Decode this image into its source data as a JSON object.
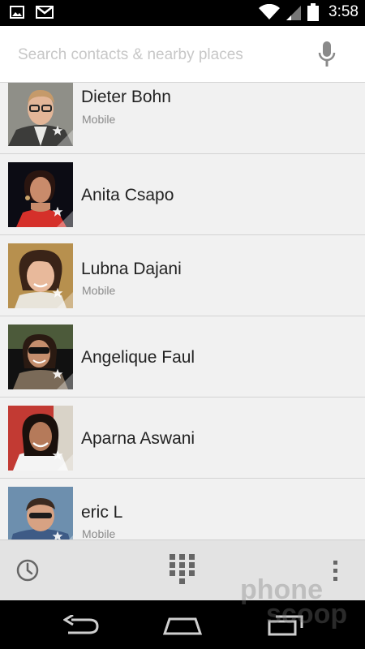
{
  "status_bar": {
    "time": "3:58",
    "left_icons": [
      "gallery-icon",
      "gmail-icon"
    ],
    "right_icons": [
      "wifi-icon",
      "signal-icon",
      "battery-icon"
    ]
  },
  "search": {
    "placeholder": "Search contacts & nearby places",
    "mic_icon": "microphone-icon"
  },
  "contacts": [
    {
      "name": "Dieter Bohn",
      "subtitle": "Mobile",
      "starred": true
    },
    {
      "name": "Anita Csapo",
      "subtitle": "",
      "starred": true
    },
    {
      "name": "Lubna Dajani",
      "subtitle": "Mobile",
      "starred": true
    },
    {
      "name": "Angelique Faul",
      "subtitle": "",
      "starred": true
    },
    {
      "name": "Aparna Aswani",
      "subtitle": "",
      "starred": true
    },
    {
      "name": "eric L",
      "subtitle": "Mobile",
      "starred": true
    }
  ],
  "bottom_bar": {
    "left_icon": "recent-calls-clock-icon",
    "center_icon": "dialpad-icon",
    "right_icon": "overflow-menu-icon"
  },
  "nav_bar": [
    "back-icon",
    "home-icon",
    "recent-apps-icon"
  ],
  "watermark": {
    "line1": "phone",
    "line2": "scoop"
  },
  "colors": {
    "status_bar": "#000000",
    "list_bg": "#f1f1f1",
    "bottom_bar": "#e3e3e3",
    "separator": "#d3d3d3"
  }
}
